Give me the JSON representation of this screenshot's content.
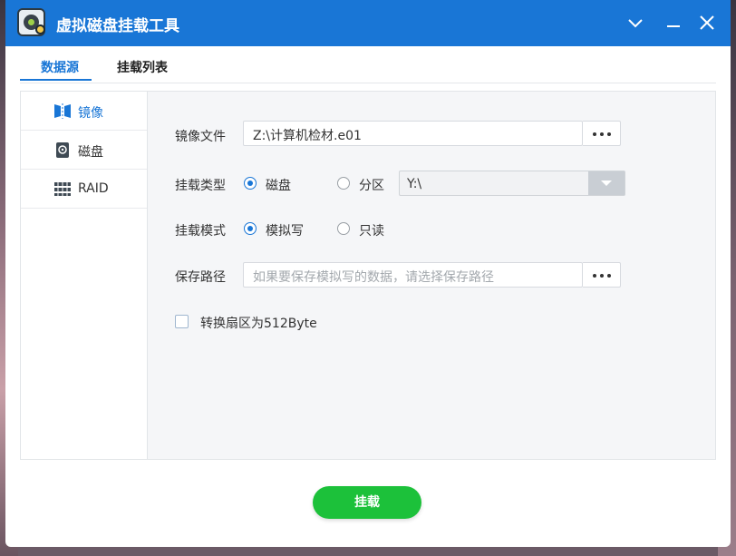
{
  "window": {
    "title": "虚拟磁盘挂载工具"
  },
  "tabs": [
    {
      "label": "数据源",
      "active": true
    },
    {
      "label": "挂载列表",
      "active": false
    }
  ],
  "sidebar": {
    "items": [
      {
        "label": "镜像",
        "icon": "mirror-icon",
        "active": true
      },
      {
        "label": "磁盘",
        "icon": "disk-icon",
        "active": false
      },
      {
        "label": "RAID",
        "icon": "raid-icon",
        "active": false
      }
    ]
  },
  "form": {
    "image_file": {
      "label": "镜像文件",
      "value": "Z:\\计算机检材.e01",
      "more": "..."
    },
    "mount_type": {
      "label": "挂载类型",
      "options": [
        {
          "label": "磁盘",
          "checked": true
        },
        {
          "label": "分区",
          "checked": false
        }
      ],
      "partition_value": "Y:\\"
    },
    "mount_mode": {
      "label": "挂载模式",
      "options": [
        {
          "label": "模拟写",
          "checked": true
        },
        {
          "label": "只读",
          "checked": false
        }
      ]
    },
    "save_path": {
      "label": "保存路径",
      "placeholder": "如果要保存模拟写的数据，请选择保存路径",
      "value": ""
    },
    "convert_sector": {
      "label": "转换扇区为512Byte",
      "checked": false
    }
  },
  "actions": {
    "mount_label": "挂载"
  },
  "colors": {
    "accent": "#1976d6",
    "mount_button": "#1cc13a"
  }
}
